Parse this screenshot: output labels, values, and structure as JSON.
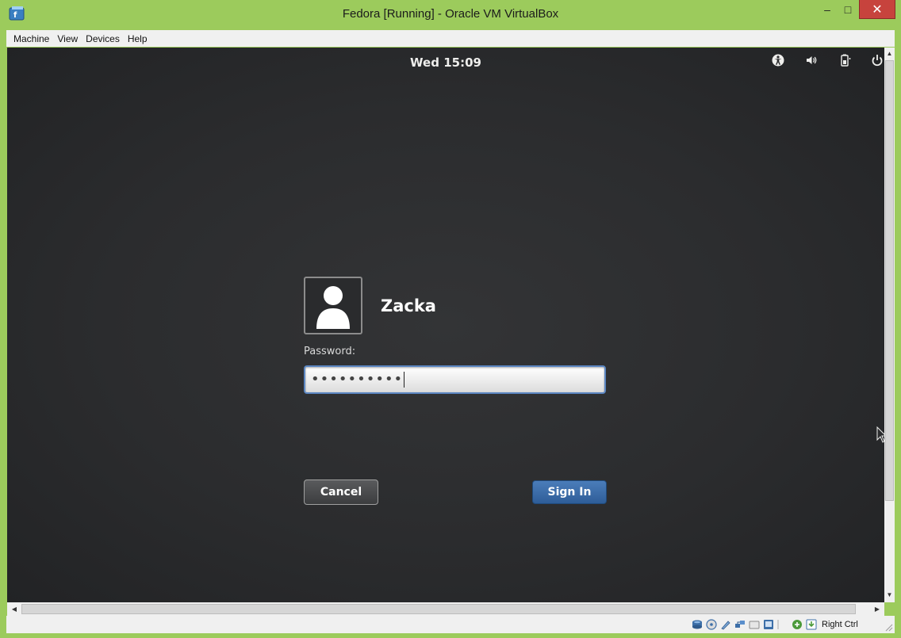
{
  "window": {
    "title": "Fedora [Running] - Oracle VM VirtualBox",
    "minimize_glyph": "–",
    "maximize_glyph": "□",
    "close_glyph": "✕"
  },
  "menubar": {
    "items": [
      "Machine",
      "View",
      "Devices",
      "Help"
    ]
  },
  "gnome": {
    "clock": "Wed 15:09",
    "tray_icons": [
      "accessibility-icon",
      "volume-icon",
      "battery-icon",
      "power-icon"
    ]
  },
  "login": {
    "username": "Zacka",
    "password_label": "Password:",
    "password_value": "••••••••••",
    "cancel_label": "Cancel",
    "signin_label": "Sign In"
  },
  "statusbar": {
    "host_key": "Right Ctrl",
    "icons": [
      "hard-disk-icon",
      "optical-drive-icon",
      "usb-icon",
      "network-icon",
      "shared-folders-icon",
      "display-icon",
      "recording-icon",
      "mouse-integration-icon",
      "host-key-icon"
    ]
  },
  "colors": {
    "frame": "#9ccb5c",
    "close_button": "#c7433d",
    "desktop": "#2b2c2e",
    "signin_button": "#3a6aa8",
    "field_focus_border": "#5b86c2"
  }
}
